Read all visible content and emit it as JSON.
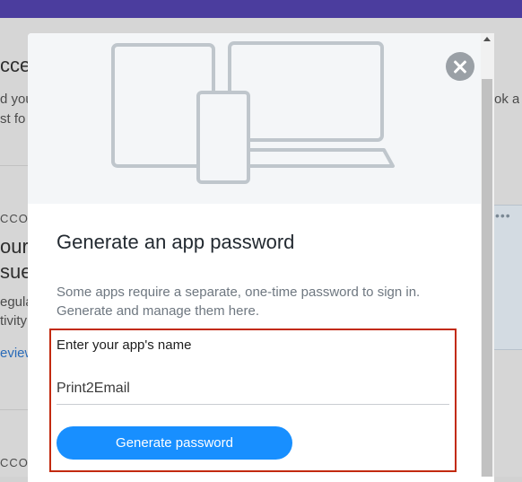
{
  "background": {
    "fragments": [
      "ccess",
      "d you",
      "st fo",
      "ok a",
      "CCOU",
      "our",
      "sue",
      "egula",
      "tivity",
      "eview",
      "CCOU"
    ],
    "dots": "•••"
  },
  "modal": {
    "title": "Generate an app password",
    "description": "Some apps require a separate, one-time password to sign in. Generate and manage them here.",
    "field_label": "Enter your app's name",
    "field_value": "Print2Email",
    "generate_button_label": "Generate password"
  },
  "colors": {
    "accent": "#188fff",
    "highlight": "#c22a0e",
    "topbar": "#4b3d9e",
    "close_button": "#9aa0a6"
  }
}
